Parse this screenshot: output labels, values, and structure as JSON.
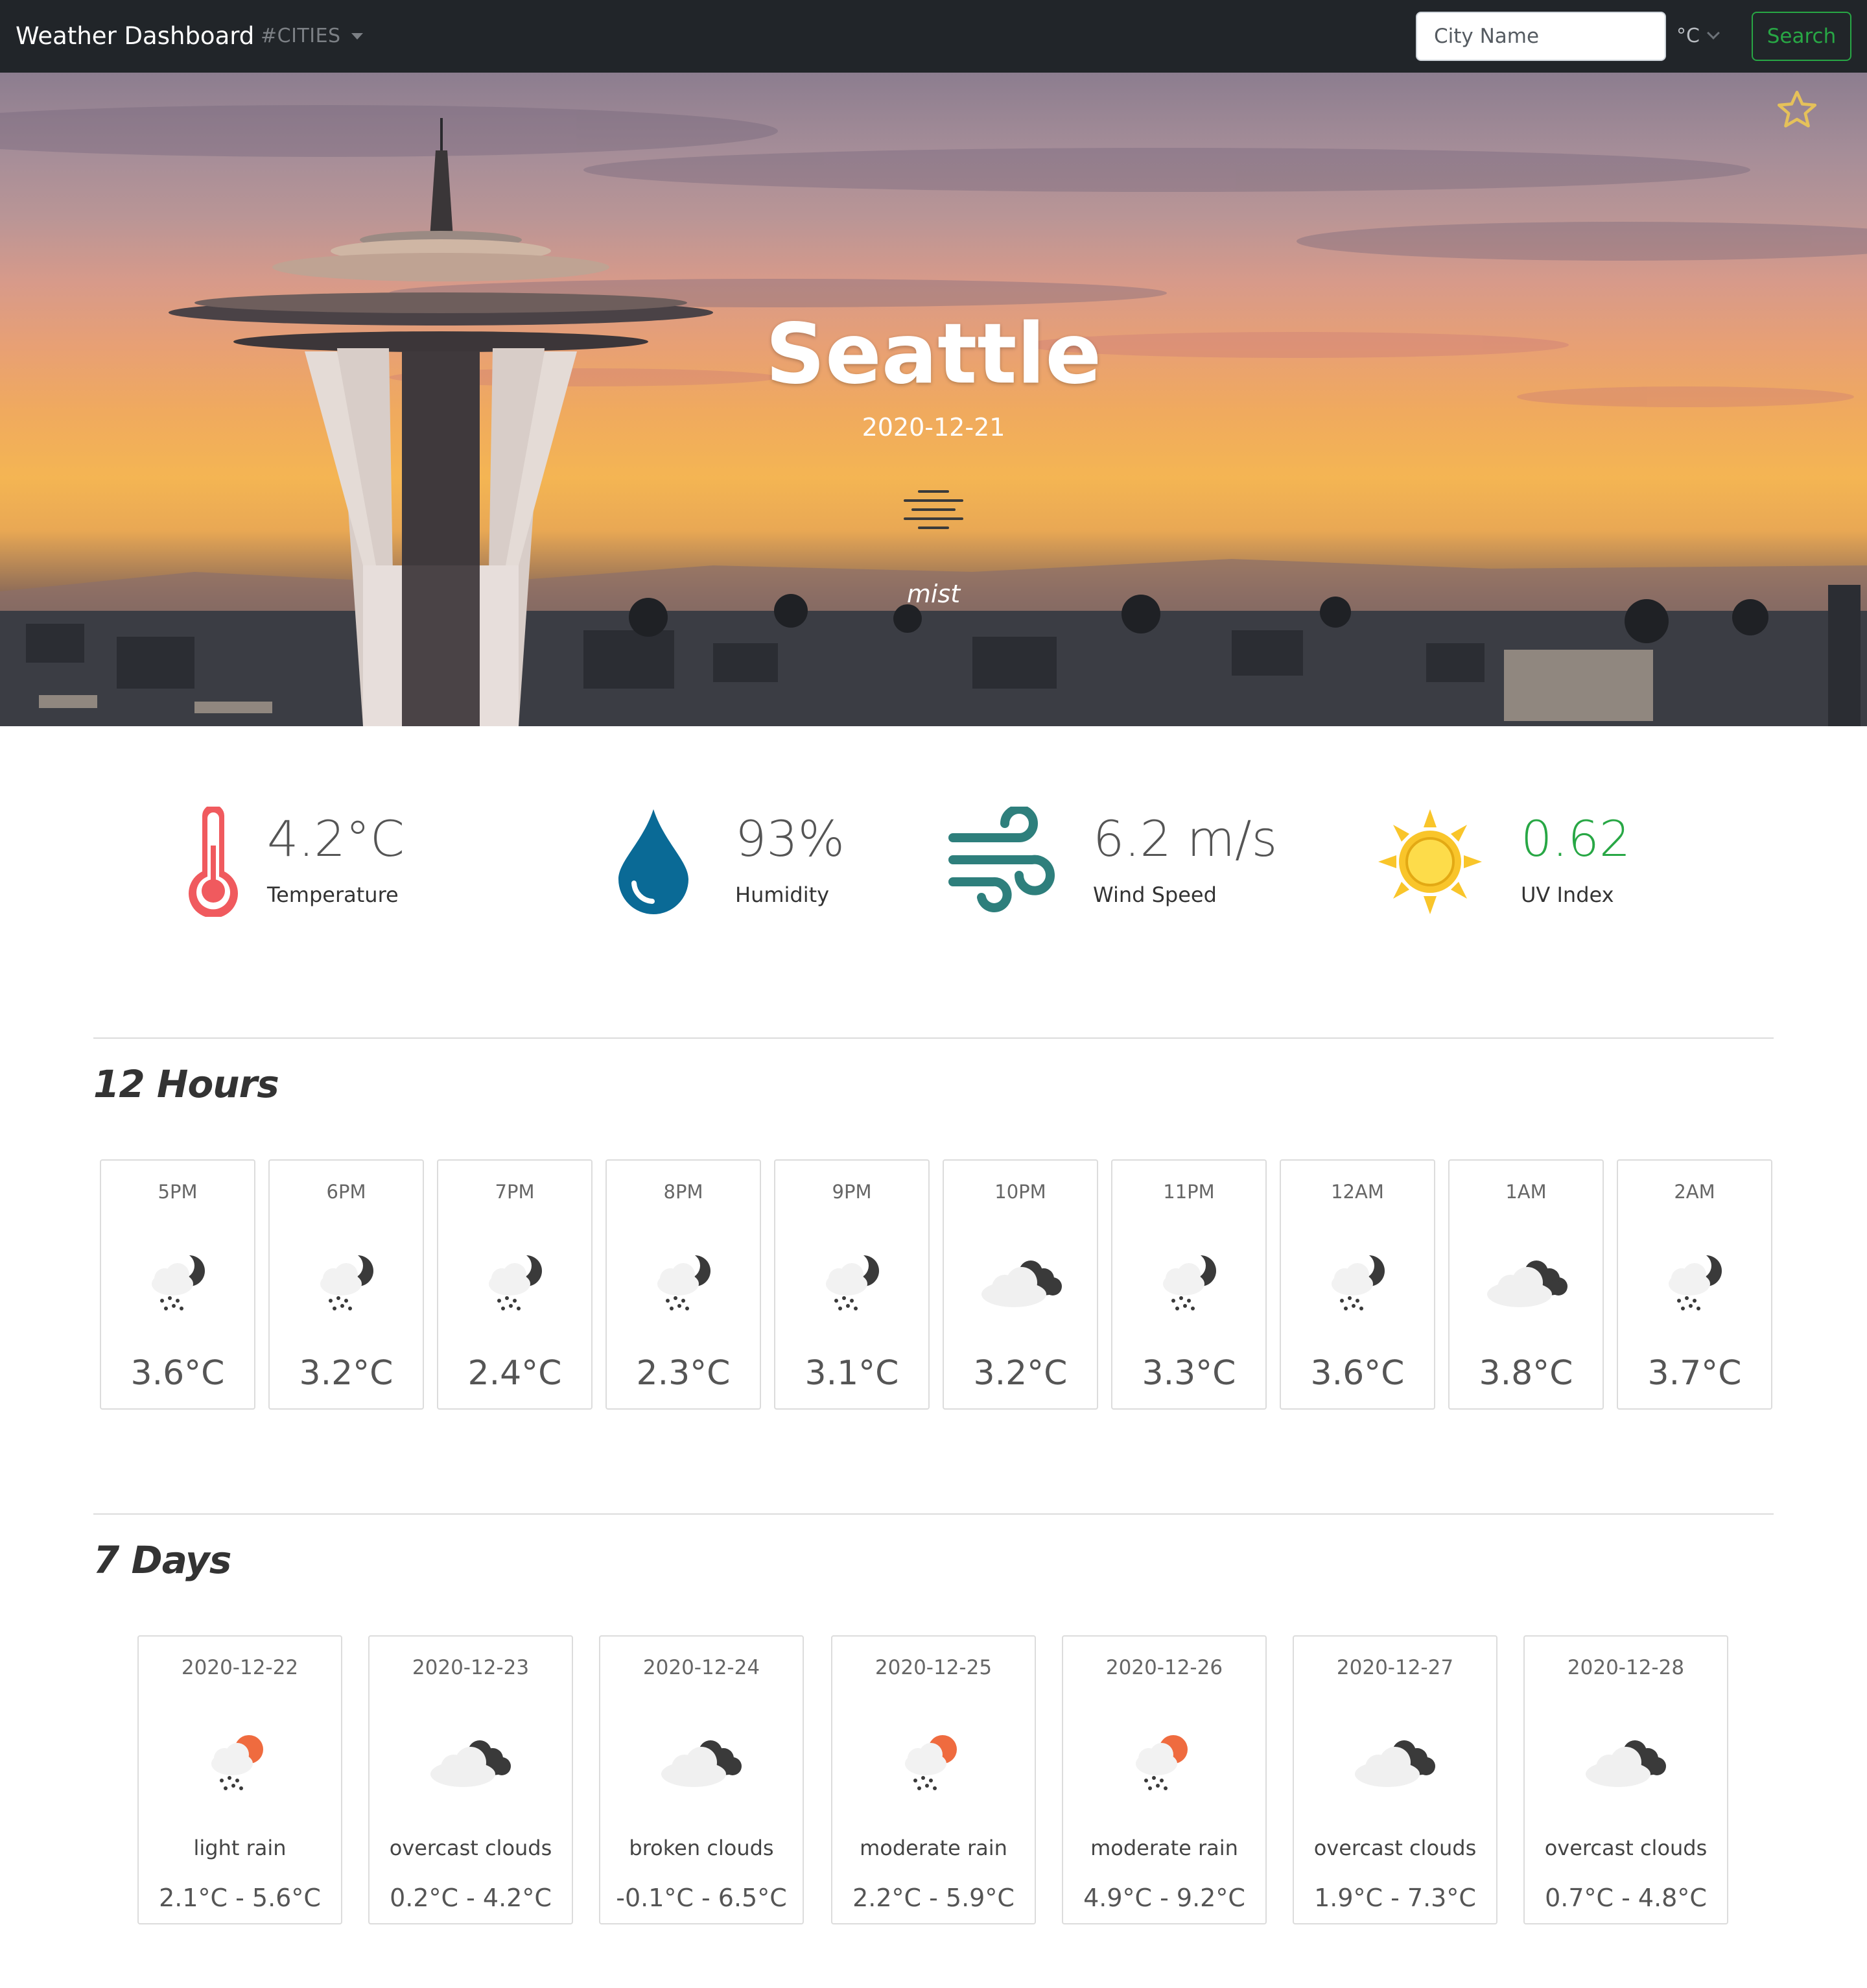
{
  "navbar": {
    "brand": "Weather Dashboard",
    "cities_menu": "#CITIES",
    "search_placeholder": "City Name",
    "unit": "°C",
    "search_label": "Search"
  },
  "hero": {
    "city": "Seattle",
    "date": "2020-12-21",
    "description": "mist",
    "icon": "mist-icon",
    "favorite_icon": "star-outline-icon"
  },
  "current": {
    "temperature": {
      "value": "4.2°C",
      "label": "Temperature",
      "icon": "thermometer-icon"
    },
    "humidity": {
      "value": "93%",
      "label": "Humidity",
      "icon": "water-drop-icon"
    },
    "wind": {
      "value": "6.2 m/s",
      "label": "Wind Speed",
      "icon": "wind-icon"
    },
    "uv": {
      "value": "0.62",
      "label": "UV Index",
      "icon": "sun-icon",
      "color": "#28a745"
    }
  },
  "hourly": {
    "title": "12 Hours",
    "items": [
      {
        "time": "5PM",
        "temp": "3.6°C",
        "icon": "night-rain-icon"
      },
      {
        "time": "6PM",
        "temp": "3.2°C",
        "icon": "night-rain-icon"
      },
      {
        "time": "7PM",
        "temp": "2.4°C",
        "icon": "night-rain-icon"
      },
      {
        "time": "8PM",
        "temp": "2.3°C",
        "icon": "night-rain-icon"
      },
      {
        "time": "9PM",
        "temp": "3.1°C",
        "icon": "night-rain-icon"
      },
      {
        "time": "10PM",
        "temp": "3.2°C",
        "icon": "overcast-clouds-icon"
      },
      {
        "time": "11PM",
        "temp": "3.3°C",
        "icon": "night-rain-icon"
      },
      {
        "time": "12AM",
        "temp": "3.6°C",
        "icon": "night-rain-icon"
      },
      {
        "time": "1AM",
        "temp": "3.8°C",
        "icon": "overcast-clouds-icon"
      },
      {
        "time": "2AM",
        "temp": "3.7°C",
        "icon": "night-rain-icon"
      }
    ]
  },
  "daily": {
    "title": "7 Days",
    "items": [
      {
        "date": "2020-12-22",
        "desc": "light rain",
        "range": "2.1°C - 5.6°C",
        "icon": "day-rain-icon"
      },
      {
        "date": "2020-12-23",
        "desc": "overcast clouds",
        "range": "0.2°C - 4.2°C",
        "icon": "overcast-clouds-icon"
      },
      {
        "date": "2020-12-24",
        "desc": "broken clouds",
        "range": "-0.1°C - 6.5°C",
        "icon": "overcast-clouds-icon"
      },
      {
        "date": "2020-12-25",
        "desc": "moderate rain",
        "range": "2.2°C - 5.9°C",
        "icon": "day-rain-icon"
      },
      {
        "date": "2020-12-26",
        "desc": "moderate rain",
        "range": "4.9°C - 9.2°C",
        "icon": "day-rain-icon"
      },
      {
        "date": "2020-12-27",
        "desc": "overcast clouds",
        "range": "1.9°C - 7.3°C",
        "icon": "overcast-clouds-icon"
      },
      {
        "date": "2020-12-28",
        "desc": "overcast clouds",
        "range": "0.7°C - 4.8°C",
        "icon": "overcast-clouds-icon"
      }
    ]
  },
  "colors": {
    "navbar_bg": "#212529",
    "success": "#28a745",
    "thermometer": "#f05a5e",
    "drop": "#0a6a96",
    "wind": "#2e7f7c",
    "sun": "#f9c52a",
    "star": "#e5c15a"
  }
}
